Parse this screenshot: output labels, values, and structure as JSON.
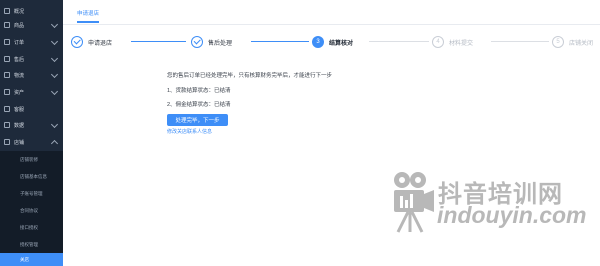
{
  "sidebar": {
    "items": [
      {
        "label": "概况"
      },
      {
        "label": "商品"
      },
      {
        "label": "订单"
      },
      {
        "label": "售后"
      },
      {
        "label": "物流"
      },
      {
        "label": "资产"
      },
      {
        "label": "客服"
      },
      {
        "label": "数据"
      },
      {
        "label": "店铺"
      }
    ],
    "sub_items": [
      {
        "label": "店铺装修"
      },
      {
        "label": "店铺基本信息"
      },
      {
        "label": "子账号管理"
      },
      {
        "label": "合同协议"
      },
      {
        "label": "接口授权"
      },
      {
        "label": "授权管理"
      },
      {
        "label": "关店"
      }
    ]
  },
  "tabs": [
    {
      "label": "申请退店"
    }
  ],
  "steps": [
    {
      "num": "1",
      "label": "申请退店",
      "state": "done"
    },
    {
      "num": "2",
      "label": "售后处理",
      "state": "done"
    },
    {
      "num": "3",
      "label": "结算核对",
      "state": "current"
    },
    {
      "num": "4",
      "label": "材料提交",
      "state": "todo"
    },
    {
      "num": "5",
      "label": "店铺关闭",
      "state": "todo"
    }
  ],
  "content": {
    "message": "您的售后订单已经处理完毕，只有核算财务完毕后，才能进行下一步",
    "item1": "1、货款结算状态：已结清",
    "item2": "2、佣金结算状态：已结清",
    "button": "处理完毕，下一步",
    "link": "修改关店联系人信息"
  },
  "watermark": {
    "cn": "抖音培训网",
    "en": "indouyin.com"
  },
  "colors": {
    "sidebar_bg": "#1e2a3b",
    "accent": "#3e8ef7"
  }
}
